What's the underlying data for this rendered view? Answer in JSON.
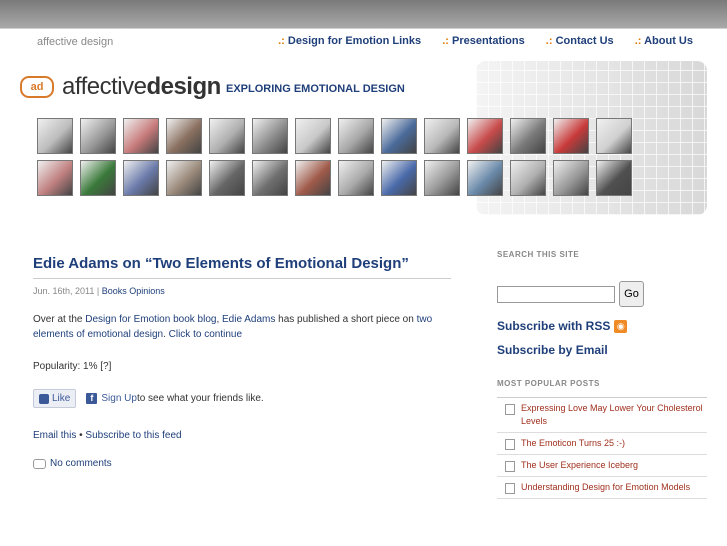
{
  "site": {
    "name": "affective design"
  },
  "nav": {
    "items": [
      {
        "prefix": ".:",
        "label": "Design for Emotion Links"
      },
      {
        "prefix": ".:",
        "label": "Presentations"
      },
      {
        "prefix": ".:",
        "label": "Contact Us"
      },
      {
        "prefix": ".:",
        "label": "About Us"
      }
    ]
  },
  "header": {
    "logo_mark": "ad",
    "logo_light": "affective",
    "logo_bold": "design",
    "tagline": "EXPLORING EMOTIONAL DESIGN"
  },
  "post": {
    "title": "Edie Adams on “Two Elements of Emotional Design”",
    "date": "Jun. 16th, 2011 | ",
    "categories": "Books Opinions",
    "body_prefix": "Over at the ",
    "link1": "Design for Emotion book blog",
    "body_mid1": ", ",
    "link2": "Edie Adams",
    "body_mid2": " has published a short piece on ",
    "link3": "two elements of emotional design",
    "body_mid3": ". ",
    "link4": "Click to continue",
    "popularity": "Popularity: 1% [?]",
    "like_label": "Like",
    "signup_label": "Sign Up",
    "signup_suffix": " to see what your friends like.",
    "email_this": "Email this",
    "separator": " • ",
    "subscribe_feed": "Subscribe to this feed",
    "comments": "No comments"
  },
  "sidebar": {
    "search_heading": "SEARCH THIS SITE",
    "search_value": "",
    "go_label": "Go",
    "rss_label": "Subscribe with RSS",
    "email_label": "Subscribe by Email",
    "popular_heading": "MOST POPULAR POSTS",
    "popular": [
      "Expressing Love May Lower Your Cholesterol Levels",
      "The Emoticon Turns 25 :-)",
      "The User Experience Iceberg",
      "Understanding Design for Emotion Models"
    ]
  },
  "colors": {
    "link": "#1f3f7a",
    "accent": "#e07a00",
    "popular_link": "#a0301e"
  }
}
